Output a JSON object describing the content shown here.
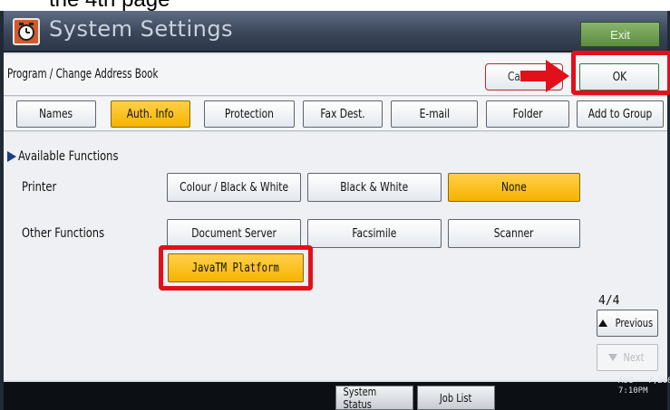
{
  "caption": "the 4th page",
  "window": {
    "title": "System Settings",
    "exit_label": "Exit"
  },
  "header": {
    "breadcrumb": "Program / Change Address Book",
    "cancel_label": "Cancel",
    "ok_label": "OK"
  },
  "tabs": [
    {
      "label": "Names",
      "selected": false
    },
    {
      "label": "Auth. Info",
      "selected": true
    },
    {
      "label": "Protection",
      "selected": false
    },
    {
      "label": "Fax Dest.",
      "selected": false
    },
    {
      "label": "E-mail",
      "selected": false
    },
    {
      "label": "Folder",
      "selected": false
    },
    {
      "label": "Add to Group",
      "selected": false
    }
  ],
  "section": {
    "heading": "Available Functions",
    "printer": {
      "label": "Printer",
      "options": [
        "Colour / Black & White",
        "Black & White",
        "None"
      ],
      "selected": "None"
    },
    "other": {
      "label": "Other Functions",
      "options": [
        "Document Server",
        "Facsimile",
        "Scanner",
        "JavaTM Platform"
      ],
      "selected": "JavaTM Platform"
    }
  },
  "pager": {
    "indicator": "4/4",
    "previous_label": "Previous",
    "next_label": "Next"
  },
  "statusbar": {
    "system_status_label": "System Status",
    "job_list_label": "Job List",
    "date": "AUG   7,2008",
    "time": "7:10PM"
  },
  "colors": {
    "selected": "#f6b300",
    "highlight": "#e2101b",
    "ok_border": "#2a7a3a",
    "title_bar": "#3a4659"
  }
}
